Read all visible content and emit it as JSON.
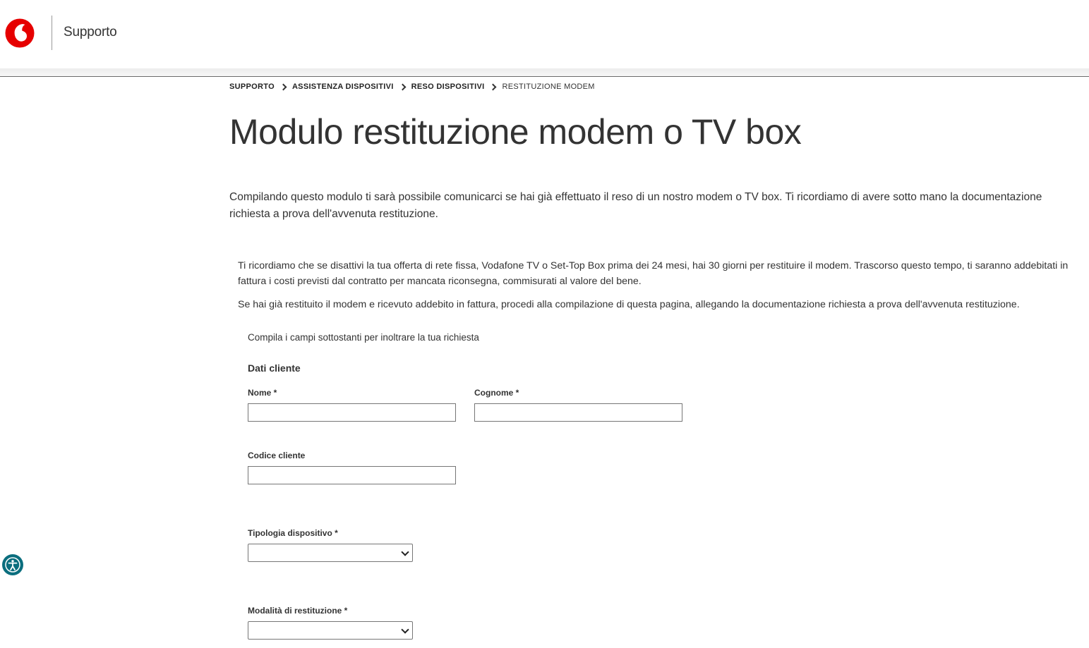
{
  "header": {
    "logo_icon": "vodafone-logo",
    "brand_color": "#e60000",
    "title": "Supporto"
  },
  "breadcrumb": [
    {
      "label": "SUPPORTO"
    },
    {
      "label": "ASSISTENZA DISPOSITIVI"
    },
    {
      "label": "RESO DISPOSITIVI"
    },
    {
      "label": "RESTITUZIONE MODEM"
    }
  ],
  "page": {
    "title": "Modulo restituzione modem o TV box",
    "intro": "Compilando questo modulo ti sarà possibile comunicarci se hai già effettuato il reso di un nostro modem o TV box. Ti ricordiamo di avere sotto mano la documentazione richiesta a prova dell'avvenuta restituzione.",
    "notice_1": "Ti ricordiamo che se disattivi la tua offerta di rete fissa, Vodafone TV o Set-Top Box prima dei 24 mesi, hai 30 giorni per restituire il modem. Trascorso questo tempo, ti saranno addebitati in fattura i costi previsti dal contratto per mancata riconsegna, commisurati al valore del bene.",
    "notice_2": "Se hai già restituito il modem e ricevuto addebito in fattura, procedi alla compilazione di questa pagina, allegando la documentazione richiesta a prova dell'avvenuta restituzione."
  },
  "form": {
    "instructions": "Compila i campi sottostanti per inoltrare la tua richiesta",
    "section_heading": "Dati cliente",
    "nome": {
      "label": "Nome *",
      "value": ""
    },
    "cognome": {
      "label": "Cognome *",
      "value": ""
    },
    "codice_cliente": {
      "label": "Codice cliente",
      "value": ""
    },
    "tipologia": {
      "label": "Tipologia dispositivo *",
      "selected": ""
    },
    "modalita": {
      "label": "Modalità di restituzione *",
      "selected": ""
    }
  },
  "accessibility": {
    "icon": "accessibility-icon",
    "color": "#0b6e7e"
  }
}
